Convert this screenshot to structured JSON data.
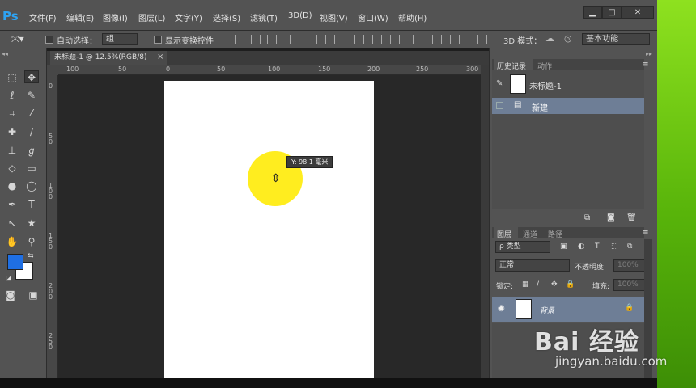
{
  "app": {
    "logo": "Ps"
  },
  "menu": [
    "文件(F)",
    "编辑(E)",
    "图像(I)",
    "图层(L)",
    "文字(Y)",
    "选择(S)",
    "滤镜(T)",
    "3D(D)",
    "视图(V)",
    "窗口(W)",
    "帮助(H)"
  ],
  "window_controls": {
    "minimize": "▁",
    "maximize": "□",
    "close": "✕"
  },
  "options_bar": {
    "auto_select_label": "自动选择：",
    "auto_select_value": "组",
    "show_transform_label": "显示变换控件",
    "mode_3d_label": "3D 模式：",
    "workspace_value": "基本功能"
  },
  "document": {
    "tab_title": "未标题-1 @ 12.5%(RGB/8)",
    "tab_close": "×",
    "h_ruler_labels": [
      "100",
      "50",
      "0",
      "50",
      "100",
      "150",
      "200",
      "250",
      "300"
    ],
    "v_ruler_labels": [
      "0",
      "50",
      "100",
      "150",
      "200",
      "250"
    ],
    "tooltip": "Y: 98.1 毫米",
    "cursor_glyph": "⇳"
  },
  "history_panel": {
    "tabs": [
      "历史记录",
      "动作"
    ],
    "snapshot_name": "未标题-1",
    "items": [
      "新建"
    ]
  },
  "layers_panel": {
    "tabs": [
      "图层",
      "通道",
      "路径"
    ],
    "filter_value": "ρ 类型",
    "blend_mode": "正常",
    "opacity_label": "不透明度:",
    "opacity_value": "100%",
    "lock_label": "锁定:",
    "fill_label": "填充:",
    "fill_value": "100%",
    "layers": [
      {
        "name": "背景",
        "locked": true,
        "visible": true
      }
    ]
  },
  "toolbox": {
    "tools": [
      "move-tool",
      "marquee-tool",
      "lasso-tool",
      "quick-select-tool",
      "crop-tool",
      "eyedropper-tool",
      "healing-brush-tool",
      "brush-tool",
      "stamp-tool",
      "history-brush-tool",
      "eraser-tool",
      "gradient-tool",
      "blur-tool",
      "dodge-tool",
      "pen-tool",
      "type-tool",
      "path-select-tool",
      "shape-tool",
      "hand-tool",
      "zoom-tool"
    ],
    "foreground_color": "#1f6fe3",
    "background_color": "#ffffff"
  },
  "watermark": {
    "brand": "Bai 经验",
    "url": "jingyan.baidu.com"
  },
  "colors": {
    "accent": "#2ea3f2",
    "selection_row": "#6e7e96",
    "guide": "#9fb0c6",
    "highlight": "#ffea00"
  }
}
